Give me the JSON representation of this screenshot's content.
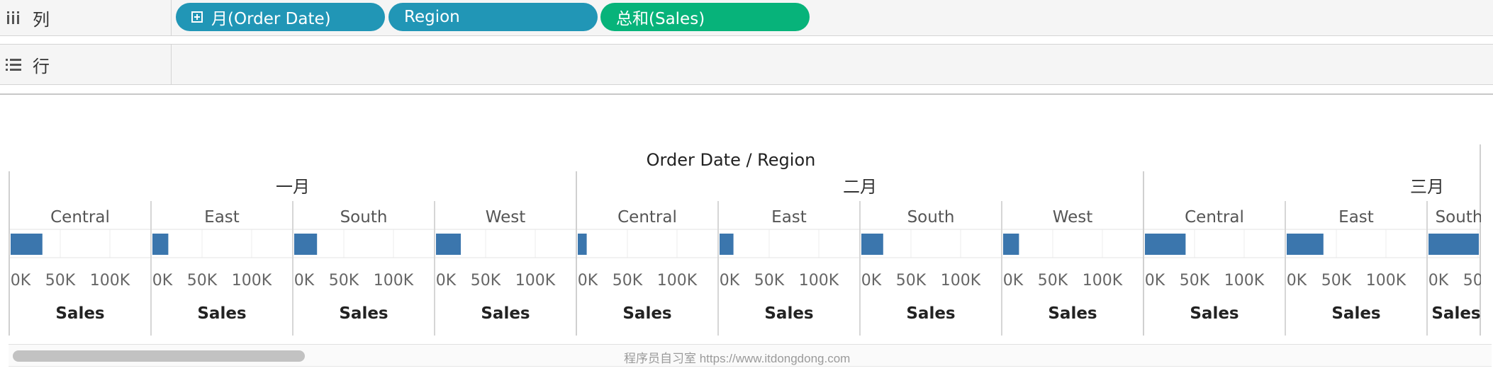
{
  "columns_shelf": {
    "label": "列",
    "pills": [
      {
        "label": "月(Order Date)",
        "color": "#2196b6",
        "has_plus": true
      },
      {
        "label": "Region",
        "color": "#2196b6",
        "has_plus": false
      },
      {
        "label": "总和(Sales)",
        "color": "#07b37a",
        "has_plus": false
      }
    ]
  },
  "rows_shelf": {
    "label": "行"
  },
  "view": {
    "header_title": "Order Date / Region",
    "axis_title": "Sales",
    "watermark": "程序员自习室 https://www.itdongdong.com"
  },
  "chart_data": {
    "type": "bar",
    "title": "Order Date / Region",
    "xlabel": "Sales",
    "x_ticks": [
      "0K",
      "50K",
      "100K"
    ],
    "xlim": [
      0,
      140000
    ],
    "bar_color": "#3b76ad",
    "panes": [
      {
        "month": "一月",
        "region": "Central",
        "value": 32000
      },
      {
        "month": "一月",
        "region": "East",
        "value": 16000
      },
      {
        "month": "一月",
        "region": "South",
        "value": 23000
      },
      {
        "month": "一月",
        "region": "West",
        "value": 25000
      },
      {
        "month": "二月",
        "region": "Central",
        "value": 9000
      },
      {
        "month": "二月",
        "region": "East",
        "value": 14000
      },
      {
        "month": "二月",
        "region": "South",
        "value": 22000
      },
      {
        "month": "二月",
        "region": "West",
        "value": 16000
      },
      {
        "month": "三月",
        "region": "Central",
        "value": 41000
      },
      {
        "month": "三月",
        "region": "East",
        "value": 37000
      },
      {
        "month": "三月",
        "region": "South",
        "value": 60000
      }
    ]
  }
}
